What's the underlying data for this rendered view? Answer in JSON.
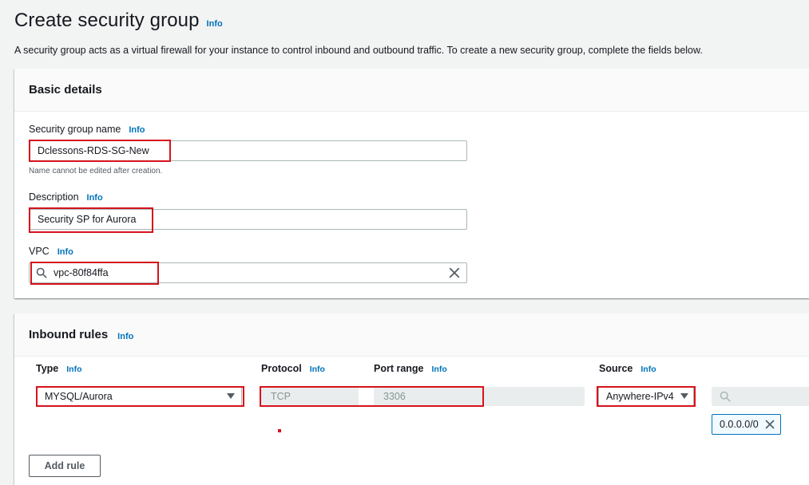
{
  "page": {
    "title": "Create security group",
    "title_info": "Info",
    "description": "A security group acts as a virtual firewall for your instance to control inbound and outbound traffic. To create a new security group, complete the fields below."
  },
  "basic_details": {
    "header": "Basic details",
    "name": {
      "label": "Security group name",
      "info": "Info",
      "value": "Dclessons-RDS-SG-New",
      "constraint": "Name cannot be edited after creation."
    },
    "description": {
      "label": "Description",
      "info": "Info",
      "value": "Security SP for Aurora"
    },
    "vpc": {
      "label": "VPC",
      "info": "Info",
      "value": "vpc-80f84ffa",
      "search_icon": "search-icon",
      "clear_icon": "close-icon"
    }
  },
  "inbound_rules": {
    "header": "Inbound rules",
    "info": "Info",
    "columns": {
      "type": "Type",
      "protocol": "Protocol",
      "port_range": "Port range",
      "source": "Source",
      "info": "Info"
    },
    "rule": {
      "type": "MYSQL/Aurora",
      "protocol": "TCP",
      "port_range": "3306",
      "source": "Anywhere-IPv4",
      "cidr_token": "0.0.0.0/0"
    },
    "add_rule_label": "Add rule"
  },
  "colors": {
    "link": "#0073bb",
    "highlight": "#d6131c",
    "background": "#f2f3f3"
  }
}
